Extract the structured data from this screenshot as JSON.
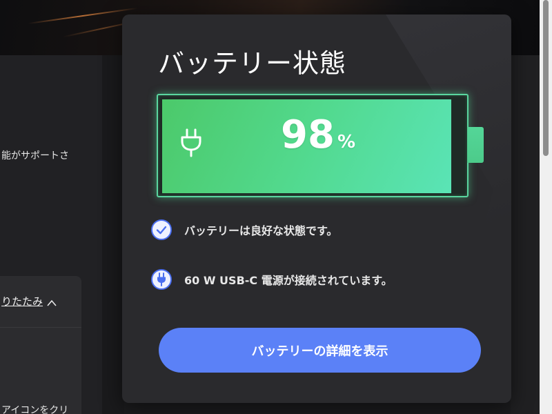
{
  "background": {
    "feature_text": "能がサポートさ",
    "collapse_label": "りたたみ",
    "bottom_text": "アイコンをクリ"
  },
  "flyout": {
    "title": "バッテリー状態",
    "battery": {
      "percent": 98,
      "percent_text": "98",
      "unit": "%",
      "icon": "plug-icon",
      "charging": true,
      "color": "#52d98e"
    },
    "status": [
      {
        "icon": "check-circle-icon",
        "text": "バッテリーは良好な状態です。"
      },
      {
        "icon": "plug-circle-icon",
        "text": "60 W USB-C 電源が接続されています。"
      }
    ],
    "details_button_label": "バッテリーの詳細を表示",
    "accent_color": "#5b81f7"
  }
}
